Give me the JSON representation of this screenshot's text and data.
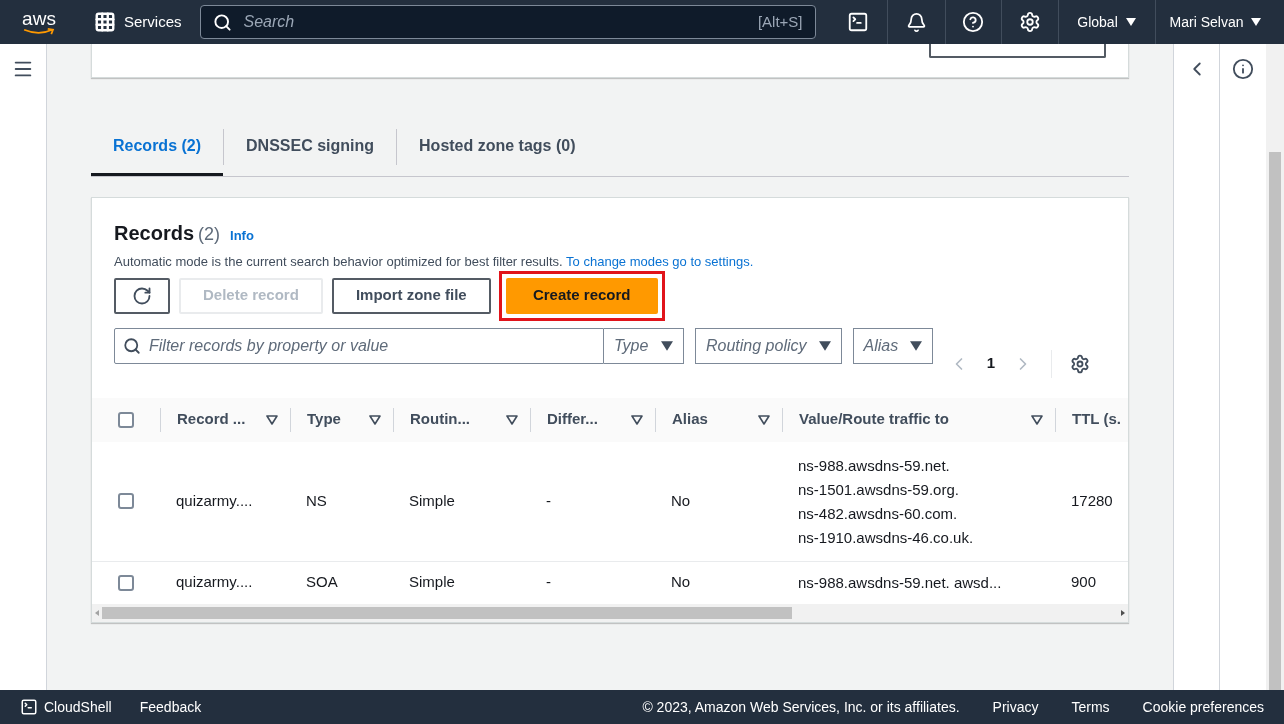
{
  "header": {
    "logo": "aws",
    "services": "Services",
    "search_placeholder": "Search",
    "shortcut": "[Alt+S]",
    "region": "Global",
    "user": "Mari Selvan"
  },
  "tabs": [
    {
      "label": "Records (2)",
      "selected": true
    },
    {
      "label": "DNSSEC signing",
      "selected": false
    },
    {
      "label": "Hosted zone tags (0)",
      "selected": false
    }
  ],
  "records": {
    "title": "Records",
    "count": "(2)",
    "info": "Info",
    "description": "Automatic mode is the current search behavior optimized for best filter results.",
    "settings_link": "To change modes go to settings.",
    "buttons": [
      {
        "label": "Delete record",
        "kind": "normal",
        "disabled": true,
        "highlighted": false
      },
      {
        "label": "Import zone file",
        "kind": "normal",
        "disabled": false,
        "highlighted": false
      },
      {
        "label": "Create record",
        "kind": "primary",
        "disabled": false,
        "highlighted": true
      }
    ],
    "filter": {
      "placeholder": "Filter records by property or value"
    },
    "dropdowns": [
      {
        "placeholder": "Type"
      },
      {
        "placeholder": "Routing policy"
      },
      {
        "placeholder": "Alias"
      }
    ],
    "page": "1",
    "table": {
      "select_all_checked": false,
      "columns": [
        "Record ...",
        "Type",
        "Routin...",
        "Differ...",
        "Alias",
        "Value/Route traffic to",
        "TTL (s."
      ],
      "rows": [
        {
          "checked": false,
          "cells": [
            "quizarmy....",
            "NS",
            "Simple",
            "-",
            "No",
            [
              "ns-988.awsdns-59.net.",
              "ns-1501.awsdns-59.org.",
              "ns-482.awsdns-60.com.",
              "ns-1910.awsdns-46.co.uk."
            ],
            "17280"
          ]
        },
        {
          "checked": false,
          "cells": [
            "quizarmy....",
            "SOA",
            "Simple",
            "-",
            "No",
            [
              "ns-988.awsdns-59.net. awsd..."
            ],
            "900"
          ]
        }
      ]
    }
  },
  "footer": {
    "cloudshell": "CloudShell",
    "feedback": "Feedback",
    "copyright": "© 2023, Amazon Web Services, Inc. or its affiliates.",
    "links": [
      "Privacy",
      "Terms",
      "Cookie preferences"
    ]
  }
}
